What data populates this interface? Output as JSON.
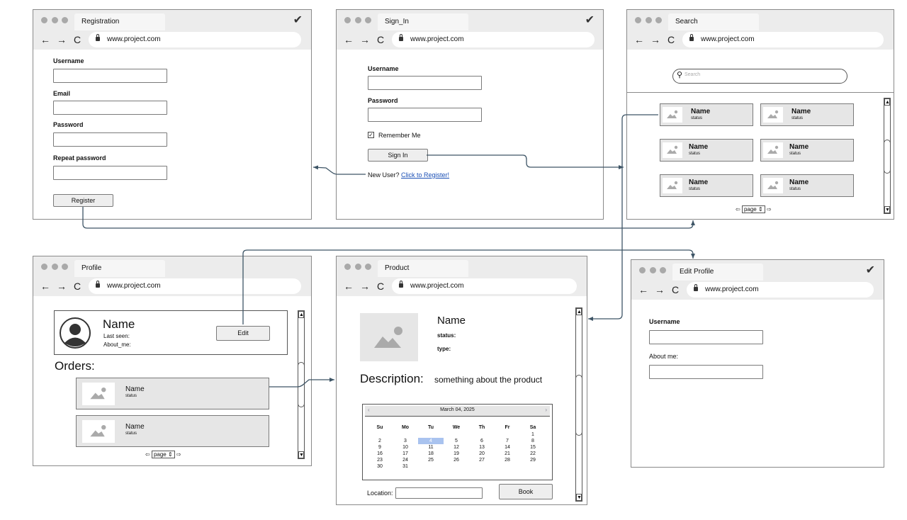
{
  "url": "www.project.com",
  "windows": {
    "registration": {
      "tab": "Registration",
      "fields": [
        "Username",
        "Email",
        "Password",
        "Repeat password"
      ],
      "button": "Register"
    },
    "signin": {
      "tab": "Sign_In",
      "username": "Username",
      "password": "Password",
      "remember": "Remember Me",
      "button": "Sign In",
      "newuser": "New User?",
      "register_link": "Click to Register!"
    },
    "search": {
      "tab": "Search",
      "placeholder": "Search",
      "cards": [
        {
          "name": "Name",
          "status": "status"
        },
        {
          "name": "Name",
          "status": "status"
        },
        {
          "name": "Name",
          "status": "status"
        },
        {
          "name": "Name",
          "status": "status"
        },
        {
          "name": "Name",
          "status": "status"
        },
        {
          "name": "Name",
          "status": "status"
        }
      ],
      "pager": "page"
    },
    "profile": {
      "tab": "Profile",
      "name": "Name",
      "last_seen": "Last seen:",
      "about": "About_me:",
      "edit": "Edit",
      "orders_title": "Orders:",
      "orders": [
        {
          "name": "Name",
          "status": "status"
        },
        {
          "name": "Name",
          "status": "status"
        }
      ],
      "pager": "page"
    },
    "product": {
      "tab": "Product",
      "name": "Name",
      "status": "status:",
      "type": "type:",
      "description_label": "Description:",
      "description": "something about the product",
      "calendar": {
        "title": "March 04, 2025",
        "days": [
          "Su",
          "Mo",
          "Tu",
          "We",
          "Th",
          "Fr",
          "Sa"
        ],
        "weeks": [
          [
            "",
            "",
            "",
            "",
            "",
            "",
            "1"
          ],
          [
            "2",
            "3",
            "4",
            "5",
            "6",
            "7",
            "8"
          ],
          [
            "9",
            "10",
            "11",
            "12",
            "13",
            "14",
            "15"
          ],
          [
            "16",
            "17",
            "18",
            "19",
            "20",
            "21",
            "22"
          ],
          [
            "23",
            "24",
            "25",
            "26",
            "27",
            "28",
            "29"
          ],
          [
            "30",
            "31",
            "",
            "",
            "",
            "",
            ""
          ]
        ],
        "selected": "4"
      },
      "location_label": "Location:",
      "book": "Book"
    },
    "editprofile": {
      "tab": "Edit Profile",
      "username": "Username",
      "about": "About me:"
    }
  },
  "colors": {
    "link": "#1a4fb5",
    "arrow": "#3e5566",
    "selected_day": "#a9c3ef"
  }
}
